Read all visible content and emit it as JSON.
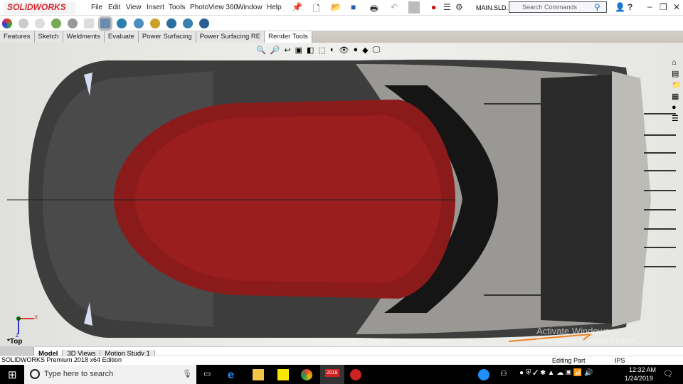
{
  "app": {
    "logo": "SOLIDWORKS",
    "file": "MAIN.SLD...",
    "search_placeholder": "Search Commands"
  },
  "menu": [
    "File",
    "Edit",
    "View",
    "Insert",
    "Tools",
    "PhotoView 360",
    "Window",
    "Help"
  ],
  "tabs": [
    "Features",
    "Sketch",
    "Weldments",
    "Evaluate",
    "Power Surfacing",
    "Power Surfacing RE",
    "Render Tools"
  ],
  "active_tab": "Render Tools",
  "view": {
    "orientation": "*Top",
    "axis_x": "X",
    "axis_z": "Z"
  },
  "bottom_tabs": [
    "Model",
    "3D Views",
    "Motion Study 1"
  ],
  "status": {
    "edition": "SOLIDWORKS Premium 2018 x64 Edition",
    "mode": "Editing Part",
    "units": "IPS"
  },
  "watermark": {
    "title": "Activate Windows",
    "subtitle": "Go to Settings to activate Windows."
  },
  "taskbar": {
    "search": "Type here to search",
    "time": "12:32 AM",
    "date": "1/24/2019",
    "sw_badge": "2018"
  }
}
